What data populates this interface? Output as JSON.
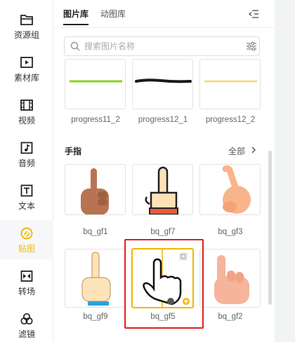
{
  "sidebar": {
    "items": [
      {
        "label": "资源组",
        "icon": "folder-icon"
      },
      {
        "label": "素材库",
        "icon": "media-library-icon"
      },
      {
        "label": "视频",
        "icon": "film-icon"
      },
      {
        "label": "音频",
        "icon": "music-note-icon"
      },
      {
        "label": "文本",
        "icon": "text-t-icon"
      },
      {
        "label": "贴图",
        "icon": "sticker-icon",
        "active": true
      },
      {
        "label": "转场",
        "icon": "transition-icon"
      },
      {
        "label": "滤镜",
        "icon": "filter-icon"
      }
    ]
  },
  "tabs": [
    {
      "label": "图片库",
      "active": true
    },
    {
      "label": "动图库"
    }
  ],
  "search": {
    "placeholder": "搜索图片名称",
    "value": ""
  },
  "progress_row": [
    {
      "caption": "progress11_2",
      "line_color": "#8bd01e"
    },
    {
      "caption": "progress12_1",
      "line_color": "#1a1a1a"
    },
    {
      "caption": "progress12_2",
      "line_color": "#f5d86a"
    }
  ],
  "section": {
    "title": "手指",
    "more": "全部"
  },
  "stickers": [
    {
      "caption": "bq_gf1"
    },
    {
      "caption": "bq_gf7"
    },
    {
      "caption": "bq_gf3"
    },
    {
      "caption": "bq_gf9"
    },
    {
      "caption": "bq_gf5",
      "selected": true
    },
    {
      "caption": "bq_gf2"
    }
  ],
  "colors": {
    "accent": "#f2b600",
    "highlight_box": "#e02020"
  }
}
